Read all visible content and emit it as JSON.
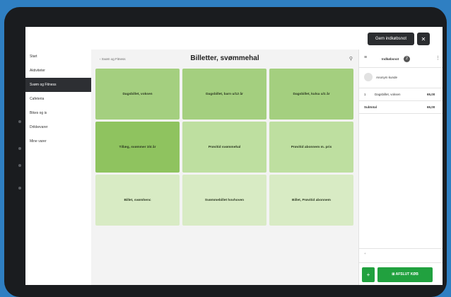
{
  "topbar": {
    "register_label": "Gem indkøbsnot",
    "close_label": "✕"
  },
  "sidebar": {
    "items": [
      {
        "label": "Start"
      },
      {
        "label": "Aktiviteter"
      },
      {
        "label": "Svøm og Fitness"
      },
      {
        "label": "Cafeteria"
      },
      {
        "label": "Bikes og is"
      },
      {
        "label": "Drikkevarer"
      },
      {
        "label": "Mine varer"
      }
    ]
  },
  "content": {
    "breadcrumb": "‹ Svøm og Fitness",
    "title": "Billetter, svømmehal",
    "tiles": [
      {
        "label": "Dagsbillet, voksen",
        "color": "#a4cf7f"
      },
      {
        "label": "Dagsbillet, barn u/12 år",
        "color": "#a4cf7f"
      },
      {
        "label": "Dagsbillet, kulsa u/1 år",
        "color": "#a4cf7f"
      },
      {
        "label": "Tillæg, svømmer 3/4 år",
        "color": "#8fc35f"
      },
      {
        "label": "Prøvitid svømmehal",
        "color": "#bedfa0"
      },
      {
        "label": "Prøvitid abonnem m. pris",
        "color": "#bedfa0"
      },
      {
        "label": "Billet, svømhenc",
        "color": "#d8ebc4"
      },
      {
        "label": "Svømmebillet hovhoven",
        "color": "#d8ebc4"
      },
      {
        "label": "Billet, Prøvitid abonnem",
        "color": "#d8ebc4"
      }
    ]
  },
  "cart": {
    "header": "Indkøbsnot",
    "count": "2",
    "customer": "Anonym kunde",
    "line_qty": "1",
    "line_name": "Dagsbillet, voksen",
    "line_price": "65,00",
    "total_label": "Subtotal",
    "total_value": "65,00",
    "note_placeholder": "+",
    "checkout_label": "⊞ AFSLUT KØB",
    "plus_label": "+"
  },
  "colors": {
    "accent_green": "#21a13f",
    "dark": "#2b2d30"
  }
}
